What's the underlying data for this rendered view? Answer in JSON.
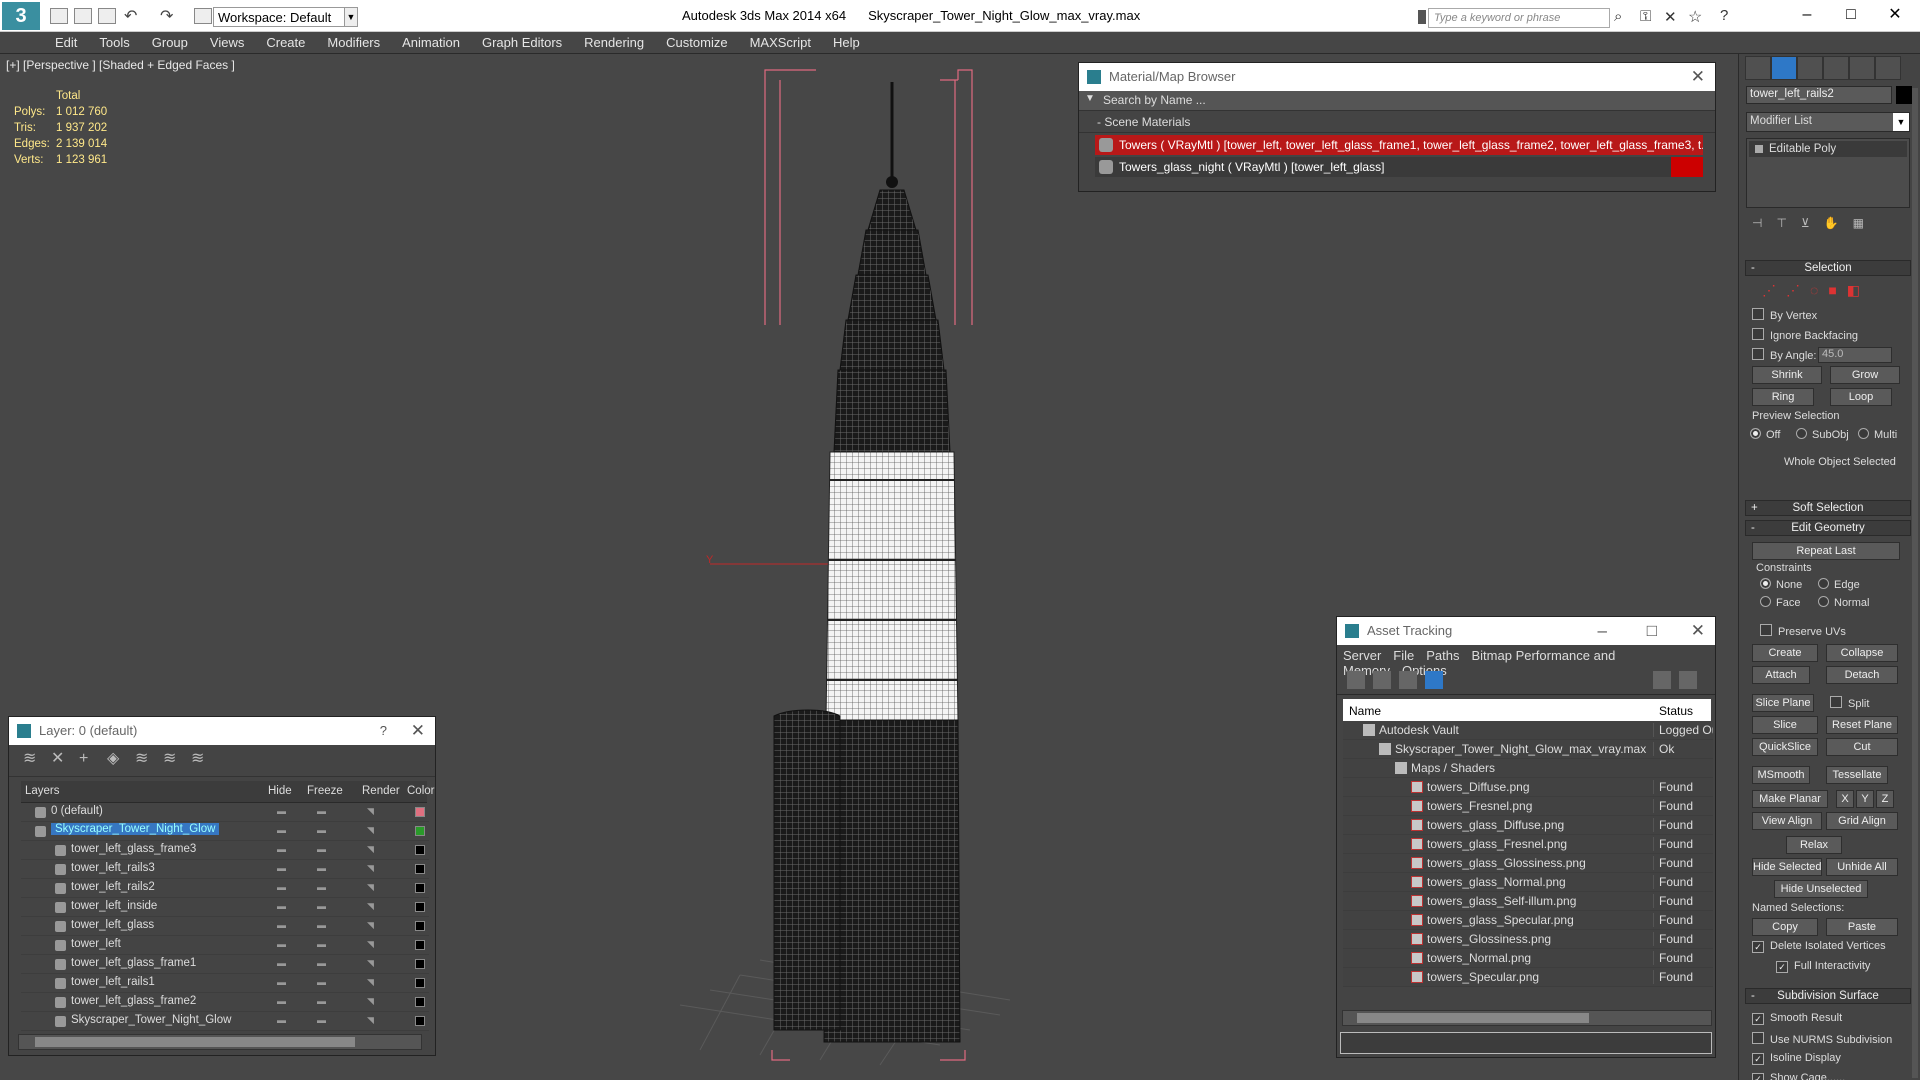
{
  "titlebar": {
    "app": "Autodesk 3ds Max  2014 x64",
    "file": "Skyscraper_Tower_Night_Glow_max_vray.max",
    "workspace": "Workspace: Default",
    "search_placeholder": "Type a keyword or phrase"
  },
  "menu": [
    "Edit",
    "Tools",
    "Group",
    "Views",
    "Create",
    "Modifiers",
    "Animation",
    "Graph Editors",
    "Rendering",
    "Customize",
    "MAXScript",
    "Help"
  ],
  "viewport": {
    "label": "[+] [Perspective ] [Shaded + Edged Faces ]",
    "stats_header": "Total",
    "stats": [
      {
        "label": "Polys:",
        "value": "1 012 760"
      },
      {
        "label": "Tris:",
        "value": "1 937 202"
      },
      {
        "label": "Edges:",
        "value": "2 139 014"
      },
      {
        "label": "Verts:",
        "value": "1 123 961"
      }
    ],
    "axis_label": "Y"
  },
  "material_browser": {
    "title": "Material/Map Browser",
    "search_placeholder": "Search by Name ...",
    "section": "Scene Materials",
    "rows": [
      "Towers ( VRayMtl ) [tower_left, tower_left_glass_frame1, tower_left_glass_frame2, tower_left_glass_frame3, t...",
      "Towers_glass_night ( VRayMtl ) [tower_left_glass]"
    ]
  },
  "layer_window": {
    "title": "Layer: 0 (default)",
    "help": "?",
    "columns": {
      "layers": "Layers",
      "hide": "Hide",
      "freeze": "Freeze",
      "render": "Render",
      "color": "Color"
    },
    "rows": [
      {
        "name": "0 (default)",
        "indent": 0,
        "color": "#e07080",
        "selected": false
      },
      {
        "name": "Skyscraper_Tower_Night_Glow",
        "indent": 0,
        "color": "#2a9a2a",
        "selected": true
      },
      {
        "name": "tower_left_glass_frame3",
        "indent": 1,
        "color": "#000000",
        "selected": false
      },
      {
        "name": "tower_left_rails3",
        "indent": 1,
        "color": "#000000",
        "selected": false
      },
      {
        "name": "tower_left_rails2",
        "indent": 1,
        "color": "#000000",
        "selected": false
      },
      {
        "name": "tower_left_inside",
        "indent": 1,
        "color": "#000000",
        "selected": false
      },
      {
        "name": "tower_left_glass",
        "indent": 1,
        "color": "#000000",
        "selected": false
      },
      {
        "name": "tower_left",
        "indent": 1,
        "color": "#000000",
        "selected": false
      },
      {
        "name": "tower_left_glass_frame1",
        "indent": 1,
        "color": "#000000",
        "selected": false
      },
      {
        "name": "tower_left_rails1",
        "indent": 1,
        "color": "#000000",
        "selected": false
      },
      {
        "name": "tower_left_glass_frame2",
        "indent": 1,
        "color": "#000000",
        "selected": false
      },
      {
        "name": "Skyscraper_Tower_Night_Glow",
        "indent": 1,
        "color": "#000000",
        "selected": false
      }
    ]
  },
  "asset_tracking": {
    "title": "Asset Tracking",
    "menu": [
      "Server",
      "File",
      "Paths",
      "Bitmap Performance and Memory",
      "Options"
    ],
    "columns": {
      "name": "Name",
      "status": "Status"
    },
    "rows": [
      {
        "name": "Autodesk Vault",
        "indent": 0,
        "status": "Logged Ou",
        "type": "vault"
      },
      {
        "name": "Skyscraper_Tower_Night_Glow_max_vray.max",
        "indent": 1,
        "status": "Ok",
        "type": "max"
      },
      {
        "name": "Maps / Shaders",
        "indent": 2,
        "status": "",
        "type": "folder"
      },
      {
        "name": "towers_Diffuse.png",
        "indent": 3,
        "status": "Found",
        "type": "png"
      },
      {
        "name": "towers_Fresnel.png",
        "indent": 3,
        "status": "Found",
        "type": "png"
      },
      {
        "name": "towers_glass_Diffuse.png",
        "indent": 3,
        "status": "Found",
        "type": "png"
      },
      {
        "name": "towers_glass_Fresnel.png",
        "indent": 3,
        "status": "Found",
        "type": "png"
      },
      {
        "name": "towers_glass_Glossiness.png",
        "indent": 3,
        "status": "Found",
        "type": "png"
      },
      {
        "name": "towers_glass_Normal.png",
        "indent": 3,
        "status": "Found",
        "type": "png"
      },
      {
        "name": "towers_glass_Self-illum.png",
        "indent": 3,
        "status": "Found",
        "type": "png"
      },
      {
        "name": "towers_glass_Specular.png",
        "indent": 3,
        "status": "Found",
        "type": "png"
      },
      {
        "name": "towers_Glossiness.png",
        "indent": 3,
        "status": "Found",
        "type": "png"
      },
      {
        "name": "towers_Normal.png",
        "indent": 3,
        "status": "Found",
        "type": "png"
      },
      {
        "name": "towers_Specular.png",
        "indent": 3,
        "status": "Found",
        "type": "png"
      }
    ]
  },
  "command_panel": {
    "object_name": "tower_left_rails2",
    "modifier_list": "Modifier List",
    "stack_item": "Editable Poly",
    "selection": {
      "title": "Selection",
      "by_vertex": "By Vertex",
      "ignore_backfacing": "Ignore Backfacing",
      "by_angle": "By Angle:",
      "angle_value": "45.0",
      "shrink": "Shrink",
      "grow": "Grow",
      "ring": "Ring",
      "loop": "Loop",
      "preview_selection": "Preview Selection",
      "off": "Off",
      "subobj": "SubObj",
      "multi": "Multi",
      "status": "Whole Object Selected"
    },
    "soft_selection": "Soft Selection",
    "edit_geometry": {
      "title": "Edit Geometry",
      "repeat_last": "Repeat Last",
      "constraints": "Constraints",
      "none": "None",
      "edge": "Edge",
      "face": "Face",
      "normal": "Normal",
      "preserve_uvs": "Preserve UVs",
      "create": "Create",
      "collapse": "Collapse",
      "attach": "Attach",
      "detach": "Detach",
      "slice_plane": "Slice Plane",
      "split": "Split",
      "slice": "Slice",
      "reset_plane": "Reset Plane",
      "quickslice": "QuickSlice",
      "cut": "Cut",
      "msmooth": "MSmooth",
      "tessellate": "Tessellate",
      "make_planar": "Make Planar",
      "x": "X",
      "y": "Y",
      "z": "Z",
      "view_align": "View Align",
      "grid_align": "Grid Align",
      "relax": "Relax",
      "hide_selected": "Hide Selected",
      "unhide_all": "Unhide All",
      "hide_unselected": "Hide Unselected",
      "named_selections": "Named Selections:",
      "copy": "Copy",
      "paste": "Paste",
      "delete_isolated": "Delete Isolated Vertices",
      "full_interactivity": "Full Interactivity"
    },
    "subdivision": {
      "title": "Subdivision Surface",
      "smooth_result": "Smooth Result",
      "use_nurms": "Use NURMS Subdivision",
      "isoline": "Isoline Display",
      "show_cage": "Show Cage......"
    }
  }
}
